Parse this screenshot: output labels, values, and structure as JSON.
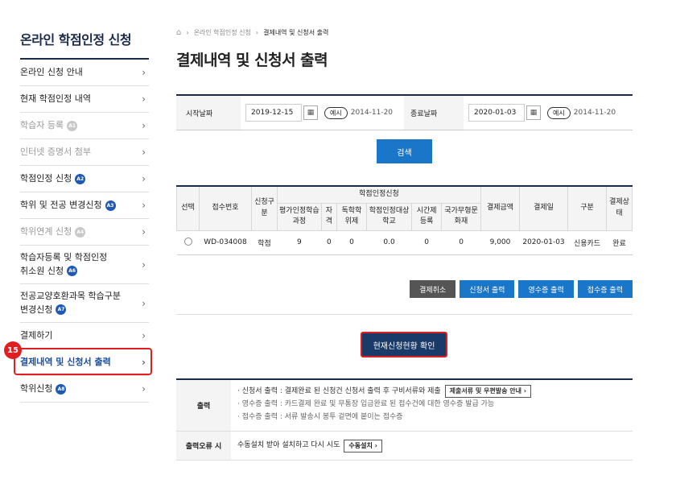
{
  "sidebar": {
    "title": "온라인 학점인정 신청",
    "items": [
      {
        "label": "온라인 신청 안내",
        "badge": "",
        "disabled": false
      },
      {
        "label": "현재 학점인정 내역",
        "badge": "",
        "disabled": false
      },
      {
        "label": "학습자 등록",
        "badge": "A1",
        "disabled": true
      },
      {
        "label": "인터넷 증명서 첨부",
        "badge": "",
        "disabled": true
      },
      {
        "label": "학점인정 신청",
        "badge": "A2",
        "disabled": false
      },
      {
        "label": "학위 및 전공 변경신청",
        "badge": "A3",
        "disabled": false
      },
      {
        "label": "학위연계 신청",
        "badge": "A4",
        "disabled": true
      },
      {
        "label_line1": "학습자등록 및 학점인정",
        "label_line2": "취소원 신청",
        "badge": "A6",
        "disabled": false
      },
      {
        "label_line1": "전공교양호환과목 학습구분",
        "label_line2": "변경신청",
        "badge": "A7",
        "disabled": false
      },
      {
        "label": "결제하기",
        "badge": "",
        "disabled": false
      },
      {
        "label": "결제내역 및 신청서 출력",
        "badge": "",
        "disabled": false,
        "active": true
      },
      {
        "label": "학위신청",
        "badge": "A8",
        "disabled": false
      }
    ],
    "step_number": "15"
  },
  "breadcrumb": [
    "온라인 학점인정 신청",
    "결제내역 및 신청서 출력"
  ],
  "page_title": "결제내역 및 신청서 출력",
  "search": {
    "start_label": "시작날짜",
    "start_value": "2019-12-15",
    "end_label": "종료날짜",
    "end_value": "2020-01-03",
    "example_pill": "예시",
    "example_date": "2014-11-20",
    "button": "검색"
  },
  "table": {
    "headers": {
      "select": "선택",
      "receipt_no": "접수번호",
      "apply_type": "신청구분",
      "group": "학점인정신청",
      "sub": [
        "평가인정학습과정",
        "자격",
        "독학학위제",
        "학점인정대상학교",
        "시간제등록",
        "국가무형문화재"
      ],
      "amount": "결제금액",
      "pay_date": "결제일",
      "method": "구분",
      "status": "결제상태"
    },
    "row": {
      "receipt_no": "WD-034008",
      "apply_type": "학점",
      "vals": [
        "9",
        "0",
        "0",
        "0.0",
        "0",
        "0"
      ],
      "amount": "9,000",
      "pay_date": "2020-01-03",
      "method": "신용카드",
      "status": "완료"
    }
  },
  "actions": [
    "결제취소",
    "신청서 출력",
    "영수증 출력",
    "접수증 출력"
  ],
  "status_button": "현재신청현황 확인",
  "info": {
    "print_head": "출력",
    "lines": [
      "신청서 출력 : 결제완료 된 신청건 신청서 출력 후 구비서류와 제출",
      "영수증 출력 : 카드결제 완료 및 무통장 입금완료 된 접수건에 대한 영수증 발급 가능",
      "접수증 출력 : 서류 발송시 봉투 겉면에 붙이는 접수증"
    ],
    "guide_button": "제출서류 및 우편발송 안내",
    "error_head": "출력오류 시",
    "error_text": "수동설치 받아 설치하고 다시 시도",
    "manual_button": "수동설치"
  }
}
